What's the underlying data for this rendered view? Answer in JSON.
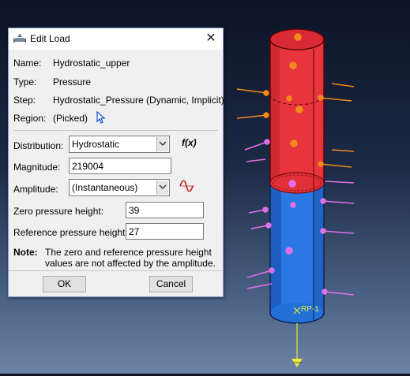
{
  "dialog": {
    "title": "Edit Load",
    "close_glyph": "✕",
    "name_label": "Name:",
    "name_value": "Hydrostatic_upper",
    "type_label": "Type:",
    "type_value": "Pressure",
    "step_label": "Step:",
    "step_value": "Hydrostatic_Pressure (Dynamic, Implicit)",
    "region_label": "Region:",
    "region_value": "(Picked)",
    "distribution_label": "Distribution:",
    "distribution_value": "Hydrostatic",
    "fx_label": "f(x)",
    "magnitude_label": "Magnitude:",
    "magnitude_value": "219004",
    "amplitude_label": "Amplitude:",
    "amplitude_value": "(Instantaneous)",
    "zero_height_label": "Zero pressure height:",
    "zero_height_value": "39",
    "ref_height_label": "Reference pressure height:",
    "ref_height_value": "27",
    "note_label": "Note:",
    "note_text": "The zero and reference pressure height values are not affected by the amplitude.",
    "ok_label": "OK",
    "cancel_label": "Cancel"
  },
  "viewport": {
    "reference_point_label": "RP-1",
    "colors": {
      "upper_cylinder": "#e8343c",
      "lower_cylinder": "#2a78e4",
      "load_arrow": "#e070e8",
      "upper_arrow": "#f08a1c",
      "rp_label": "#e8e840"
    },
    "icons": [
      "edit-load-icon",
      "region-pick-cursor-icon",
      "amplitude-wave-icon"
    ]
  }
}
